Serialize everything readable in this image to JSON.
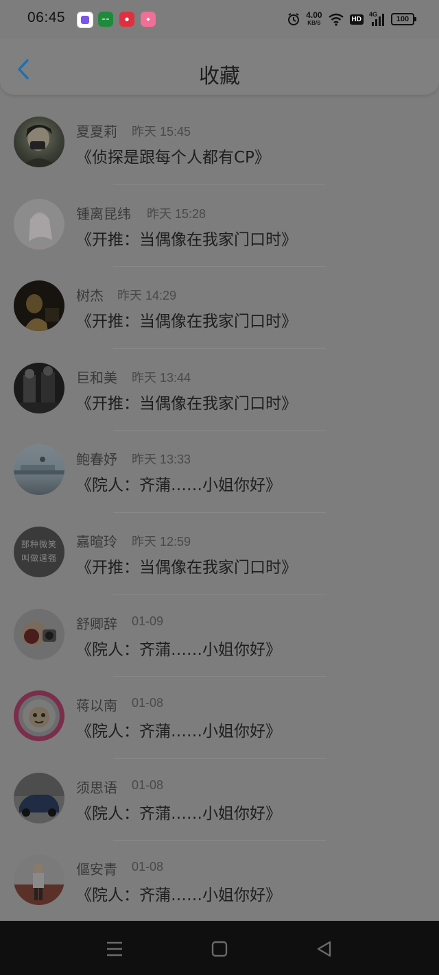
{
  "status_bar": {
    "time": "06:45",
    "speed_value": "4.00",
    "speed_unit": "KB/S",
    "hd": "HD",
    "network": "4G",
    "battery": "100",
    "app_icons": [
      {
        "name": "app1",
        "color": "#8a63f0"
      },
      {
        "name": "app2",
        "color": "#1e8a3c"
      },
      {
        "name": "app3",
        "color": "#e03040"
      },
      {
        "name": "app4",
        "color": "#f06f96"
      }
    ]
  },
  "header": {
    "title": "收藏"
  },
  "favorites": [
    {
      "name": "夏夏莉",
      "time": "昨天 15:45",
      "title": "《侦探是跟每个人都有CP》"
    },
    {
      "name": "锺离昆纬",
      "time": "昨天 15:28",
      "title": "《开推：当偶像在我家门口时》"
    },
    {
      "name": "树杰",
      "time": "昨天 14:29",
      "title": "《开推：当偶像在我家门口时》"
    },
    {
      "name": "巨和美",
      "time": "昨天 13:44",
      "title": "《开推：当偶像在我家门口时》"
    },
    {
      "name": "鲍春妤",
      "time": "昨天 13:33",
      "title": "《院人：齐蒲……小姐你好》"
    },
    {
      "name": "嘉暄玲",
      "time": "昨天 12:59",
      "title": "《开推：当偶像在我家门口时》"
    },
    {
      "name": "舒卿辞",
      "time": "01-09",
      "title": "《院人：齐蒲……小姐你好》"
    },
    {
      "name": "蒋以南",
      "time": "01-08",
      "title": "《院人：齐蒲……小姐你好》"
    },
    {
      "name": "须思语",
      "time": "01-08",
      "title": "《院人：齐蒲……小姐你好》"
    },
    {
      "name": "傴安青",
      "time": "01-08",
      "title": "《院人：齐蒲……小姐你好》"
    }
  ],
  "avatar_texts": {
    "item6_line1": "那种微笑",
    "item6_line2": "叫做逞强"
  },
  "nav": {
    "menu_icon": "menu-icon",
    "home_icon": "home-icon",
    "back_icon": "back-triangle-icon"
  }
}
